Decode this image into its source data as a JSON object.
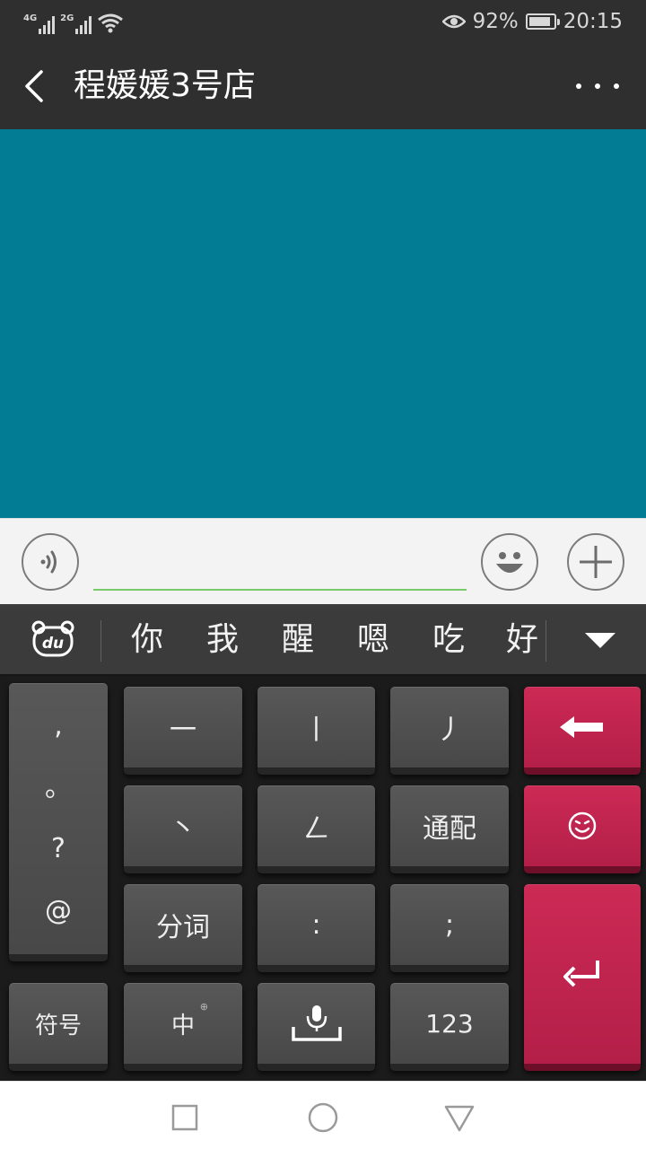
{
  "status_bar": {
    "network_1": "4G",
    "network_2": "2G",
    "battery": "92%",
    "battery_level": 0.92,
    "time": "20:15"
  },
  "header": {
    "title": "程媛媛3号店"
  },
  "chat_input": {
    "value": "",
    "placeholder": ""
  },
  "candidates": [
    "你",
    "我",
    "醒",
    "嗯",
    "吃",
    "好"
  ],
  "keyboard": {
    "punctuation": [
      ",",
      "。",
      "?",
      "@"
    ],
    "row1": [
      "一",
      "丨",
      "丿"
    ],
    "row2": [
      "丶",
      "ㄥ",
      "通配"
    ],
    "row3": [
      "分词",
      ":",
      ";"
    ],
    "row4": [
      "符号",
      "中",
      "123"
    ],
    "mode_indicator": "⊕"
  },
  "colors": {
    "header_bg": "#2f2f2f",
    "content_bg": "#017c94",
    "accent_green": "#79c96a",
    "keyboard_red": "#c4244f"
  }
}
